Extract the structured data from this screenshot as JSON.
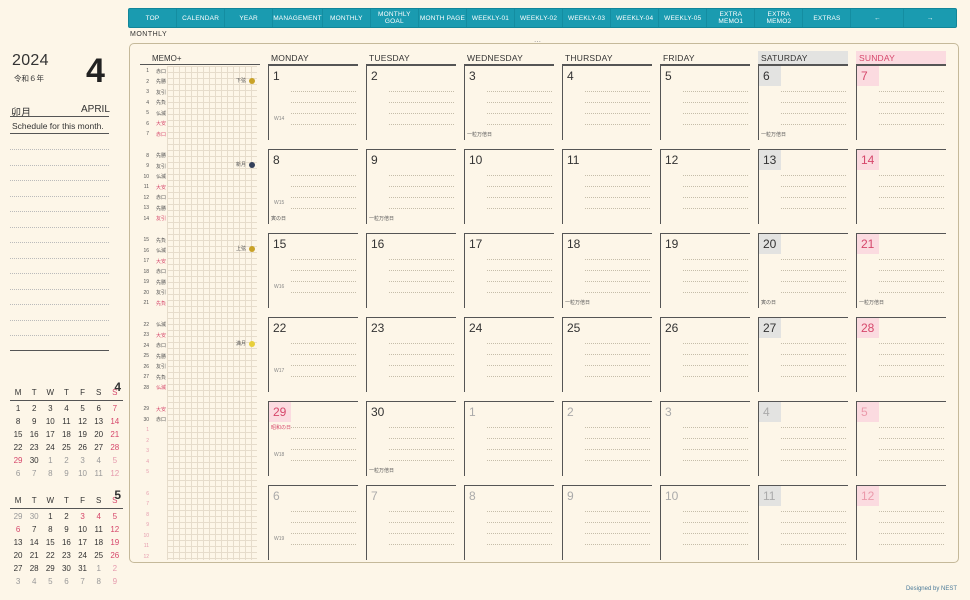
{
  "nav": [
    "TOP",
    "CALENDAR",
    "YEAR",
    "MANAGEMENT",
    "MONTHLY",
    "MONTHLY\nGOAL",
    "MONTH PAGE",
    "WEEKLY-01",
    "WEEKLY-02",
    "WEEKLY-03",
    "WEEKLY-04",
    "WEEKLY-05",
    "EXTRA MEMO1",
    "EXTRA MEMO2",
    "EXTRAS",
    "←",
    "→"
  ],
  "page_label": "MONTHLY",
  "top_mark": "⋯",
  "year": "2024",
  "era": "令和６年",
  "month_number": "4",
  "month_kanji": "卯月",
  "month_english": "APRIL",
  "schedule_label": "Schedule for this month.",
  "minical_header": [
    "M",
    "T",
    "W",
    "T",
    "F",
    "S",
    "S"
  ],
  "minical_april": {
    "num": "4",
    "rows": [
      [
        "1",
        "2",
        "3",
        "4",
        "5",
        "6",
        "7"
      ],
      [
        "8",
        "9",
        "10",
        "11",
        "12",
        "13",
        "14"
      ],
      [
        "15",
        "16",
        "17",
        "18",
        "19",
        "20",
        "21"
      ],
      [
        "22",
        "23",
        "24",
        "25",
        "26",
        "27",
        "28"
      ],
      [
        "29",
        "30",
        "1",
        "2",
        "3",
        "4",
        "5"
      ],
      [
        "6",
        "7",
        "8",
        "9",
        "10",
        "11",
        "12"
      ]
    ]
  },
  "minical_may": {
    "num": "5",
    "rows": [
      [
        "29",
        "30",
        "1",
        "2",
        "3",
        "4",
        "5"
      ],
      [
        "6",
        "7",
        "8",
        "9",
        "10",
        "11",
        "12"
      ],
      [
        "13",
        "14",
        "15",
        "16",
        "17",
        "18",
        "19"
      ],
      [
        "20",
        "21",
        "22",
        "23",
        "24",
        "25",
        "26"
      ],
      [
        "27",
        "28",
        "29",
        "30",
        "31",
        "1",
        "2"
      ],
      [
        "3",
        "4",
        "5",
        "6",
        "7",
        "8",
        "9"
      ]
    ]
  },
  "memo_title": "MEMO+",
  "memo_rows": [
    [
      "1",
      "赤口"
    ],
    [
      "2",
      "先勝"
    ],
    [
      "3",
      "友引"
    ],
    [
      "4",
      "先負"
    ],
    [
      "5",
      "仏滅"
    ],
    [
      "6",
      "大安"
    ],
    [
      "7",
      "赤口"
    ],
    [
      "8",
      "先勝"
    ],
    [
      "9",
      "友引"
    ],
    [
      "10",
      "仏滅"
    ],
    [
      "11",
      "大安"
    ],
    [
      "12",
      "赤口"
    ],
    [
      "13",
      "先勝"
    ],
    [
      "14",
      "友引"
    ],
    [
      "15",
      "先負"
    ],
    [
      "16",
      "仏滅"
    ],
    [
      "17",
      "大安"
    ],
    [
      "18",
      "赤口"
    ],
    [
      "19",
      "先勝"
    ],
    [
      "20",
      "友引"
    ],
    [
      "21",
      "先負"
    ],
    [
      "22",
      "仏滅"
    ],
    [
      "23",
      "大安"
    ],
    [
      "24",
      "赤口"
    ],
    [
      "25",
      "先勝"
    ],
    [
      "26",
      "友引"
    ],
    [
      "27",
      "先負"
    ],
    [
      "28",
      "仏滅"
    ],
    [
      "29",
      "大安"
    ],
    [
      "30",
      "赤口"
    ],
    [
      "1",
      ""
    ],
    [
      "2",
      ""
    ],
    [
      "3",
      ""
    ],
    [
      "4",
      ""
    ],
    [
      "5",
      ""
    ],
    [
      "6",
      ""
    ],
    [
      "7",
      ""
    ],
    [
      "8",
      ""
    ],
    [
      "9",
      ""
    ],
    [
      "10",
      ""
    ],
    [
      "11",
      ""
    ],
    [
      "12",
      ""
    ]
  ],
  "moon_phases": [
    {
      "label": "下弦",
      "color": "#c9a227"
    },
    {
      "label": "新月",
      "color": "#33405a"
    },
    {
      "label": "上弦",
      "color": "#c9a227"
    },
    {
      "label": "満月",
      "color": "#e8cf3a"
    }
  ],
  "day_headers": [
    "MONDAY",
    "TUESDAY",
    "WEDNESDAY",
    "THURSDAY",
    "FRIDAY",
    "SATURDAY",
    "SUNDAY"
  ],
  "weeks": [
    {
      "wk": "W14",
      "days": [
        "1",
        "2",
        "3",
        "4",
        "5",
        "6",
        "7"
      ],
      "notes": {
        "2": "一粒万倍日",
        "5": "一粒万倍日"
      }
    },
    {
      "wk": "W15",
      "days": [
        "8",
        "9",
        "10",
        "11",
        "12",
        "13",
        "14"
      ],
      "notes": {
        "0": "寅の日",
        "1": "一粒万倍日"
      }
    },
    {
      "wk": "W16",
      "days": [
        "15",
        "16",
        "17",
        "18",
        "19",
        "20",
        "21"
      ],
      "notes": {
        "3": "一粒万倍日",
        "5": "寅の日",
        "6": "一粒万倍日"
      }
    },
    {
      "wk": "W17",
      "days": [
        "22",
        "23",
        "24",
        "25",
        "26",
        "27",
        "28"
      ],
      "notes": {}
    },
    {
      "wk": "W18",
      "days": [
        "29",
        "30",
        "1",
        "2",
        "3",
        "4",
        "5"
      ],
      "notes": {
        "1": "一粒万倍日"
      },
      "holiday": "昭和の日"
    },
    {
      "wk": "W19",
      "days": [
        "6",
        "7",
        "8",
        "9",
        "10",
        "11",
        "12"
      ],
      "notes": {}
    }
  ],
  "credit": "Designed by NEST"
}
